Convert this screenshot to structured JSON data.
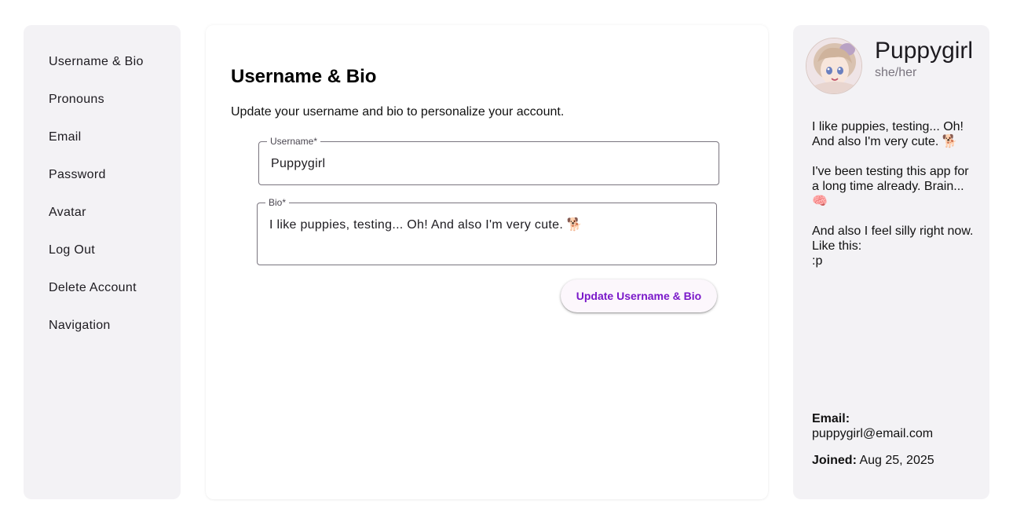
{
  "nav": {
    "items": [
      {
        "label": "Username & Bio"
      },
      {
        "label": "Pronouns"
      },
      {
        "label": "Email"
      },
      {
        "label": "Password"
      },
      {
        "label": "Avatar"
      },
      {
        "label": "Log Out"
      },
      {
        "label": "Delete Account"
      },
      {
        "label": "Navigation"
      }
    ]
  },
  "main": {
    "title": "Username & Bio",
    "subtitle": "Update your username and bio to personalize your account.",
    "username_label": "Username*",
    "username_value": "Puppygirl",
    "bio_label": "Bio*",
    "bio_value": "I like puppies, testing... Oh! And also I'm very cute. 🐕",
    "update_button": "Update Username & Bio"
  },
  "profile": {
    "name": "Puppygirl",
    "pronouns": "she/her",
    "bio_lines": [
      "I like puppies, testing... Oh! And also I'm very cute. 🐕",
      "",
      "I've been testing this app for a long time already. Brain... 🧠",
      "",
      "And also I feel silly right now. Like this:",
      ":p"
    ],
    "email_label": "Email:",
    "email": "puppygirl@email.com",
    "joined_label": "Joined:",
    "joined": "Aug 25, 2025"
  },
  "colors": {
    "accent": "#7a18c9",
    "panel_bg": "#f3f2f5",
    "button_bg": "#fcf7fc"
  }
}
